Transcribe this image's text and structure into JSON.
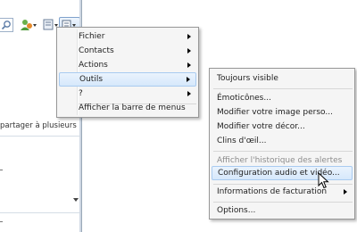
{
  "colors": {
    "menu_bg": "#f5f5f5",
    "highlight": "#d6e8fb",
    "highlight_border": "#a9cbf0",
    "disabled_text": "#8c8c8c"
  },
  "background": {
    "panel_text": "partager à plusieurs"
  },
  "main_menu": {
    "items": [
      {
        "label": "Fichier",
        "submenu": true
      },
      {
        "label": "Contacts",
        "submenu": true
      },
      {
        "label": "Actions",
        "submenu": true
      },
      {
        "label": "Outils",
        "submenu": true,
        "highlighted": true
      },
      {
        "label": "?",
        "submenu": true
      },
      {
        "label": "Afficher la barre de menus",
        "submenu": false
      }
    ]
  },
  "tools_submenu": {
    "items": [
      {
        "label": "Toujours visible"
      },
      {
        "label": "Émoticônes..."
      },
      {
        "label": "Modifier votre image perso..."
      },
      {
        "label": "Modifier votre décor..."
      },
      {
        "label": "Clins d'œil..."
      },
      {
        "label": "Afficher l'historique des alertes",
        "disabled": true
      },
      {
        "label": "Configuration audio et vidéo...",
        "highlighted": true
      },
      {
        "label": "Informations de facturation",
        "submenu": true
      },
      {
        "label": "Options..."
      }
    ]
  },
  "icons": [
    "search-icon",
    "contact-menu-icon",
    "layout-icon",
    "menu-icon",
    "mouse-cursor-icon"
  ]
}
